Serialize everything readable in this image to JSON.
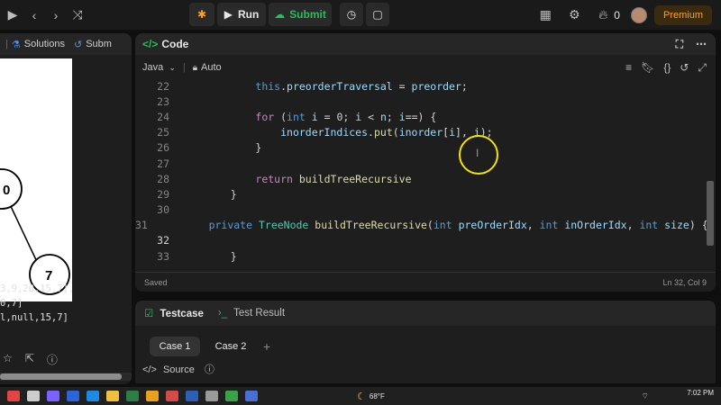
{
  "topbar": {
    "run_label": "Run",
    "submit_label": "Submit",
    "streak_count": "0",
    "premium_label": "Premium"
  },
  "left_panel": {
    "tabs": [
      "Solutions",
      "Subm"
    ],
    "tree_nodes": [
      "0",
      "7"
    ],
    "text_lines": [
      "3,9,20,15,7],",
      "0,7]",
      "l,null,15,7]"
    ]
  },
  "code_panel": {
    "title": "Code",
    "language": "Java",
    "mode": "Auto",
    "status_saved": "Saved",
    "cursor_pos": "Ln 32, Col 9",
    "lines": [
      {
        "n": "22",
        "tokens": [
          [
            "ws",
            "        "
          ],
          [
            "kw",
            "this"
          ],
          [
            "p",
            "."
          ],
          [
            "va",
            "preorderTraversal"
          ],
          [
            "p",
            " = "
          ],
          [
            "va",
            "preorder"
          ],
          [
            "p",
            ";"
          ]
        ]
      },
      {
        "n": "23",
        "tokens": []
      },
      {
        "n": "24",
        "tokens": [
          [
            "ws",
            "        "
          ],
          [
            "ac",
            "for"
          ],
          [
            "p",
            " ("
          ],
          [
            "kw",
            "int"
          ],
          [
            "p",
            " "
          ],
          [
            "va",
            "i"
          ],
          [
            "p",
            " = 0; "
          ],
          [
            "va",
            "i"
          ],
          [
            "p",
            " < "
          ],
          [
            "va",
            "n"
          ],
          [
            "p",
            "; "
          ],
          [
            "va",
            "i"
          ],
          [
            "p",
            "==) {"
          ]
        ]
      },
      {
        "n": "25",
        "tokens": [
          [
            "ws",
            "            "
          ],
          [
            "va",
            "inorderIndices"
          ],
          [
            "p",
            "."
          ],
          [
            "fn",
            "put"
          ],
          [
            "p",
            "("
          ],
          [
            "va",
            "inorder"
          ],
          [
            "p",
            "["
          ],
          [
            "va",
            "i"
          ],
          [
            "p",
            "], "
          ],
          [
            "va",
            "i"
          ],
          [
            "p",
            ");"
          ]
        ]
      },
      {
        "n": "26",
        "tokens": [
          [
            "ws",
            "        "
          ],
          [
            "p",
            "}"
          ]
        ]
      },
      {
        "n": "27",
        "tokens": []
      },
      {
        "n": "28",
        "tokens": [
          [
            "ws",
            "        "
          ],
          [
            "ac",
            "return"
          ],
          [
            "p",
            " "
          ],
          [
            "fn",
            "buildTreeRecursive"
          ]
        ]
      },
      {
        "n": "29",
        "tokens": [
          [
            "ws",
            "    "
          ],
          [
            "p",
            "}"
          ]
        ]
      },
      {
        "n": "30",
        "tokens": []
      },
      {
        "n": "31",
        "tokens": [
          [
            "ws",
            "    "
          ],
          [
            "kw",
            "private"
          ],
          [
            "p",
            " "
          ],
          [
            "ty",
            "TreeNode"
          ],
          [
            "p",
            " "
          ],
          [
            "fn",
            "buildTreeRecursive"
          ],
          [
            "p",
            "("
          ],
          [
            "kw",
            "int"
          ],
          [
            "p",
            " "
          ],
          [
            "va",
            "preOrderIdx"
          ],
          [
            "p",
            ", "
          ],
          [
            "kw",
            "int"
          ],
          [
            "p",
            " "
          ],
          [
            "va",
            "inOrderIdx"
          ],
          [
            "p",
            ", "
          ],
          [
            "kw",
            "int"
          ],
          [
            "p",
            " "
          ],
          [
            "va",
            "size"
          ],
          [
            "p",
            ") {"
          ]
        ]
      },
      {
        "n": "32",
        "tokens": []
      },
      {
        "n": "33",
        "tokens": [
          [
            "ws",
            "    "
          ],
          [
            "p",
            "}"
          ]
        ]
      }
    ]
  },
  "test_panel": {
    "tab_testcase": "Testcase",
    "tab_result": "Test Result",
    "case1": "Case 1",
    "case2": "Case 2",
    "add": "+",
    "source_label": "Source"
  },
  "taskbar": {
    "temperature": "68°F",
    "time": "7:02 PM"
  },
  "colors": {
    "accent_green": "#2cbb5d",
    "premium_orange": "#ffa116",
    "cursor_highlight": "#f2e600"
  }
}
